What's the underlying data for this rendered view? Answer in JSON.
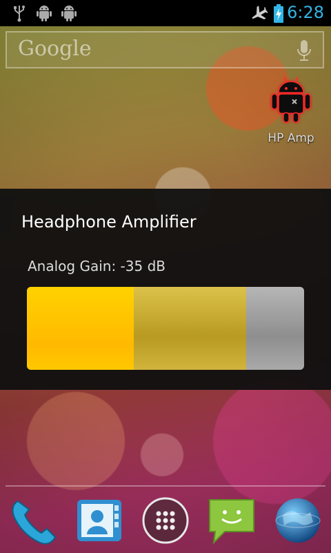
{
  "status_bar": {
    "left_icons": [
      "usb-icon",
      "android-debug-icon",
      "android-debug-icon"
    ],
    "right_icons": [
      "airplane-mode-icon",
      "battery-charging-icon"
    ],
    "clock": "6:28",
    "accent_color": "#33b5e5"
  },
  "search": {
    "logo": "Google",
    "mic_icon": "mic-icon"
  },
  "shortcut": {
    "icon": "android-robot-icon",
    "label": "HP Amp"
  },
  "dialog": {
    "title": "Headphone Amplifier",
    "gain_label": "Analog Gain: -35 dB",
    "bar": {
      "level_fraction": 0.385,
      "limit_fraction": 0.79,
      "level_color": "#ffc400",
      "limit_color": "#c9ad36",
      "track_color": "#a0a0a0"
    }
  },
  "dock": {
    "items": [
      "phone-icon",
      "contacts-icon",
      "app-drawer-icon",
      "messaging-icon",
      "browser-icon"
    ]
  }
}
